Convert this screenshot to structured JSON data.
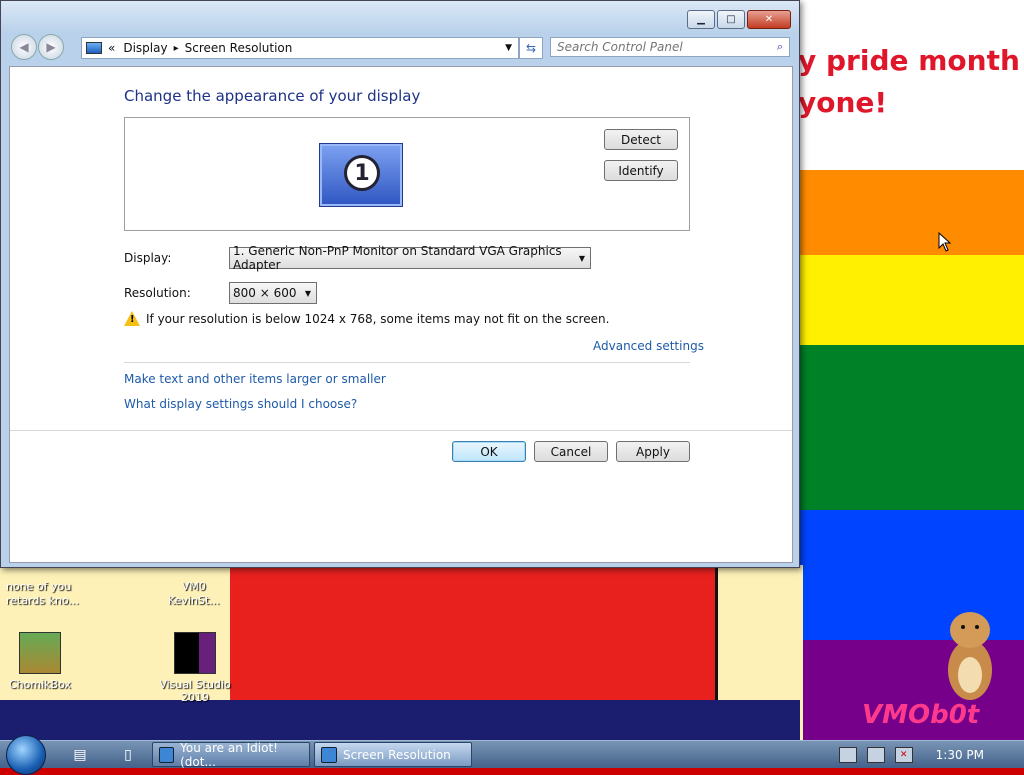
{
  "window": {
    "breadcrumb_prefix": "«",
    "breadcrumb": [
      "Display",
      "Screen Resolution"
    ],
    "breadcrumb_sep": "▸",
    "search_placeholder": "Search Control Panel",
    "heading": "Change the appearance of your display",
    "monitor_number": "1",
    "detect_label": "Detect",
    "identify_label": "Identify",
    "display_label": "Display:",
    "display_value": "1. Generic Non-PnP Monitor on Standard VGA Graphics Adapter",
    "resolution_label": "Resolution:",
    "resolution_value": "800 × 600",
    "warning_text": "If your resolution is below 1024 x 768, some items may not fit on the screen.",
    "advanced_link": "Advanced settings",
    "link_text_size": "Make text and other items larger or smaller",
    "link_help": "What display settings should I choose?",
    "ok_label": "OK",
    "cancel_label": "Cancel",
    "apply_label": "Apply"
  },
  "desktop": {
    "banner_line1": "y pride month",
    "banner_line2": "yone!",
    "text_note": "none of you\nretards kno...",
    "icons": [
      {
        "label": "ChomikBox"
      },
      {
        "label": "Visual Studio\n2019"
      }
    ],
    "partial_icon_label": "VM0\nKevinSt...",
    "watermark": "VMOb0t"
  },
  "taskbar": {
    "tasks": [
      {
        "label": "You are an Idiot! (dot..."
      },
      {
        "label": "Screen Resolution"
      }
    ],
    "clock": "1:30 PM"
  },
  "colors": {
    "heading": "#1e3287",
    "link": "#1e5aa8",
    "window_frame": "#b9d1ea"
  }
}
